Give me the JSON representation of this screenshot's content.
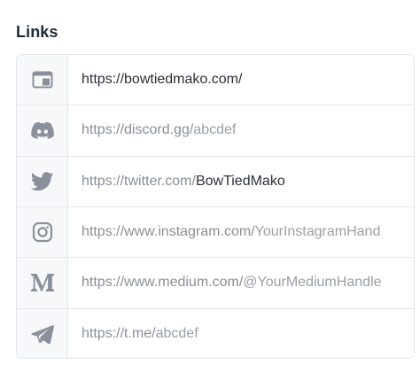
{
  "section": {
    "title": "Links"
  },
  "links": [
    {
      "icon": "website-icon",
      "full_url": "https://bowtiedmako.com/"
    },
    {
      "icon": "discord-icon",
      "prefix": "https://discord.gg/",
      "placeholder": "abcdef"
    },
    {
      "icon": "twitter-icon",
      "prefix": "https://twitter.com/",
      "value": "BowTiedMako"
    },
    {
      "icon": "instagram-icon",
      "prefix": "https://www.instagram.com/",
      "placeholder": "YourInstagramHand"
    },
    {
      "icon": "medium-icon",
      "prefix": "https://www.medium.com/",
      "placeholder": "@YourMediumHandle"
    },
    {
      "icon": "telegram-icon",
      "prefix": "https://t.me/",
      "placeholder": "abcdef"
    }
  ],
  "colors": {
    "icon": "#8a919a",
    "icon_bg": "#f7f8fa",
    "border": "#e6e8eb",
    "text_value": "#2c3036",
    "text_prefix": "#8a8f96"
  }
}
